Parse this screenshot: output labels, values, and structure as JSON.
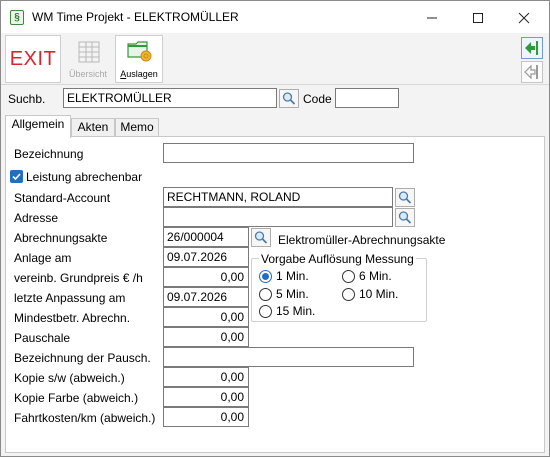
{
  "window": {
    "title": "WM Time Projekt - ELEKTROMÜLLER",
    "app_icon": "§",
    "controls": {
      "minimize": "minimize-icon",
      "maximize": "maximize-icon",
      "close": "close-icon"
    }
  },
  "toolbar": {
    "exit_label": "EXIT",
    "uebersicht_label": "Übersicht",
    "auslagen_label": "Auslagen",
    "nav_icons": [
      "arrow-left-green-icon",
      "arrow-left-grey-icon"
    ]
  },
  "search": {
    "label": "Suchb.",
    "value": "ELEKTROMÜLLER",
    "code_label": "Code",
    "code_value": ""
  },
  "tabs": [
    {
      "label": "Allgemein",
      "selected": true
    },
    {
      "label": "Akten",
      "selected": false
    },
    {
      "label": "Memo",
      "selected": false
    }
  ],
  "form": {
    "bezeichnung": {
      "label": "Bezeichnung",
      "value": ""
    },
    "leistung": {
      "label": "Leistung abrechenbar",
      "checked": true
    },
    "standard_account": {
      "label": "Standard-Account",
      "value": "RECHTMANN, ROLAND"
    },
    "adresse": {
      "label": "Adresse",
      "value": ""
    },
    "abrechnungsakte": {
      "label": "Abrechnungsakte",
      "value": "26/000004",
      "name": "Elektromüller-Abrechnungsakte"
    },
    "anlage_am": {
      "label": "Anlage am",
      "value": "09.07.2026"
    },
    "grundpreis": {
      "label": "vereinb. Grundpreis € /h",
      "value": "0,00"
    },
    "letzte_anpassung": {
      "label": "letzte Anpassung am",
      "value": "09.07.2026"
    },
    "mindestbetr": {
      "label": "Mindestbetr. Abrechn.",
      "value": "0,00"
    },
    "pauschale": {
      "label": "Pauschale",
      "value": "0,00"
    },
    "bez_pauschale": {
      "label": "Bezeichnung der Pausch.",
      "value": ""
    },
    "kopie_sw": {
      "label": "Kopie s/w (abweich.)",
      "value": "0,00"
    },
    "kopie_farbe": {
      "label": "Kopie Farbe (abweich.)",
      "value": "0,00"
    },
    "fahrtkosten": {
      "label": "Fahrtkosten/km (abweich.)",
      "value": "0,00"
    }
  },
  "aufloesung": {
    "title": "Vorgabe Auflösung Messung",
    "options": [
      {
        "label": "1 Min.",
        "selected": true
      },
      {
        "label": "6 Min.",
        "selected": false
      },
      {
        "label": "5 Min.",
        "selected": false
      },
      {
        "label": "10 Min.",
        "selected": false
      },
      {
        "label": "15 Min.",
        "selected": false
      }
    ]
  },
  "colors": {
    "accent": "#1f6fc5",
    "exit_red": "#d7262b",
    "nav_green": "#2e9b3a"
  }
}
